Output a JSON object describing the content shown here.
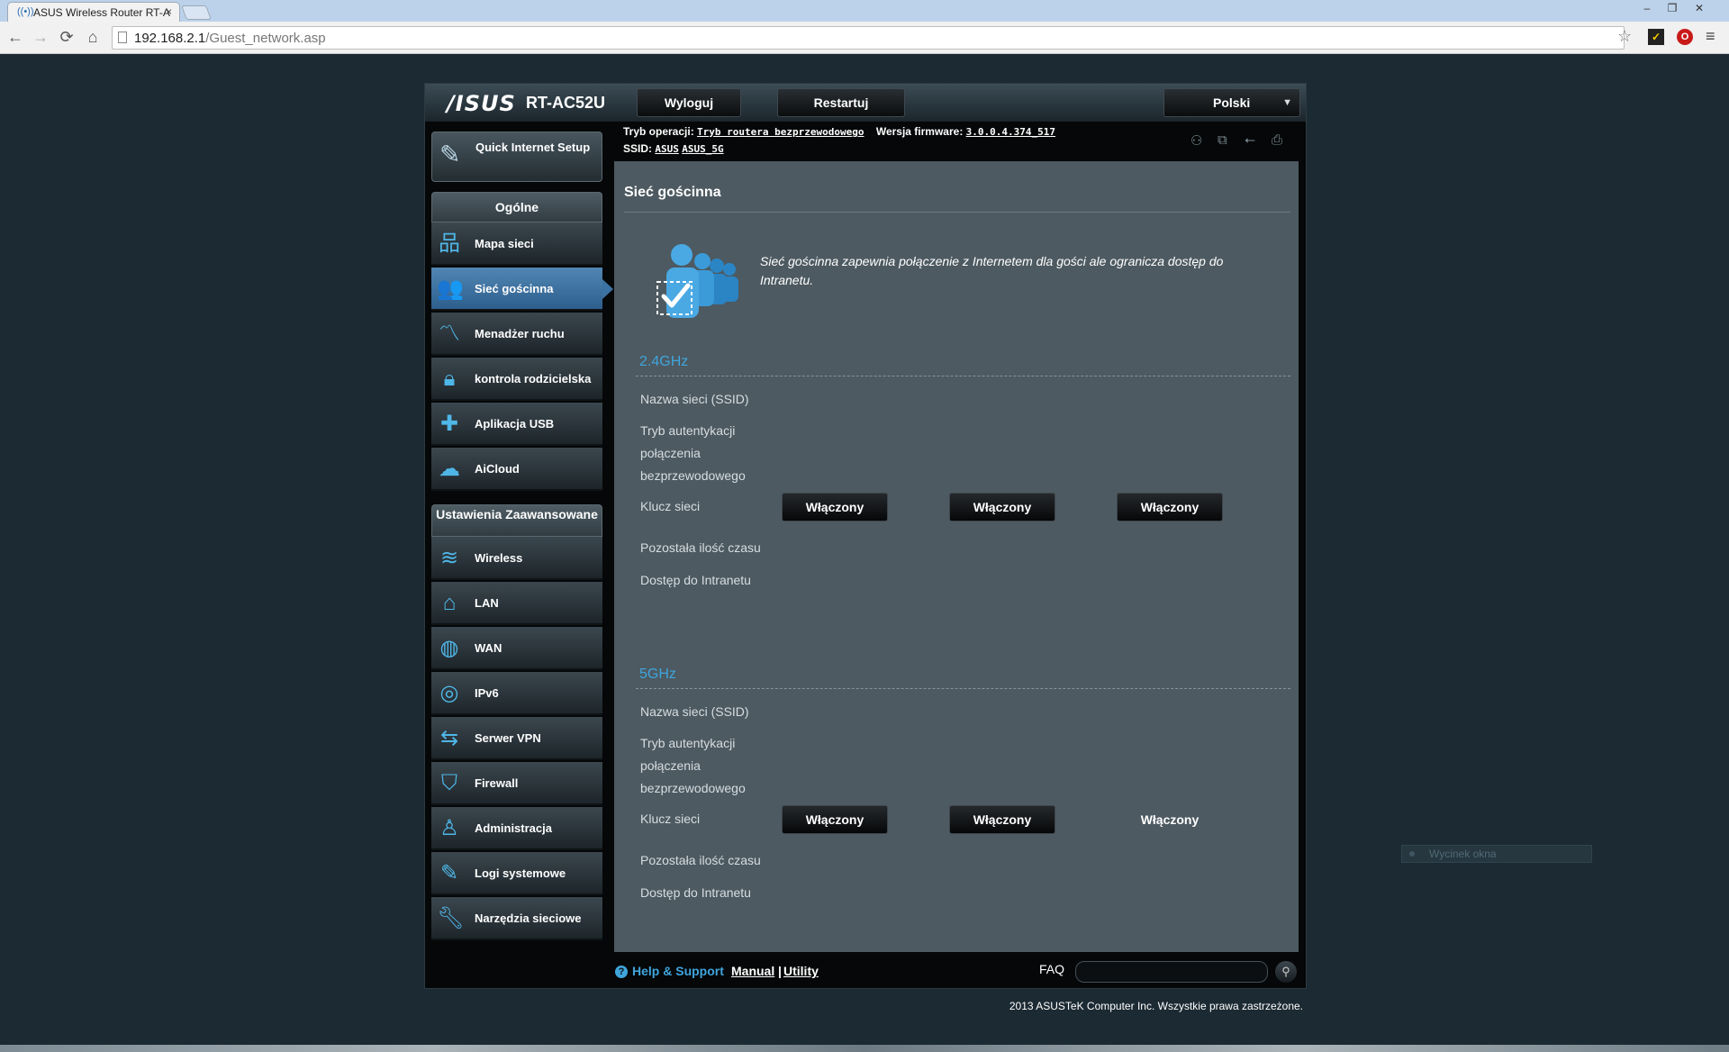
{
  "browser": {
    "tab_title": "ASUS Wireless Router RT-A",
    "tab_close": "×",
    "url_host": "192.168.2.1",
    "url_path": "/Guest_network.asp",
    "nav": {
      "back": "←",
      "forward": "→",
      "reload": "⟳",
      "home": "⌂"
    },
    "window_controls": {
      "minimize": "–",
      "restore": "❐",
      "close": "✕"
    },
    "star": "☆",
    "menu": "≡",
    "ext1": "✓",
    "ext2": "O"
  },
  "router": {
    "logo": "/ISUS",
    "model": "RT-AC52U",
    "logout_label": "Wyloguj",
    "restart_label": "Restartuj",
    "language": "Polski",
    "op_mode_label": "Tryb operacji:",
    "op_mode_value": "Tryb routera bezprzewodowego",
    "firmware_label": "Wersja firmware:",
    "firmware_value": "3.0.0.4.374_517",
    "ssid_label": "SSID:",
    "ssid_values": [
      "ASUS",
      "ASUS_5G"
    ]
  },
  "sidebar": {
    "quick_setup": "Quick Internet Setup",
    "general_header": "Ogólne",
    "general_items": [
      {
        "label": "Mapa sieci",
        "icon": "network-map-icon"
      },
      {
        "label": "Sieć gościnna",
        "icon": "guest-network-icon",
        "active": true
      },
      {
        "label": "Menadżer ruchu",
        "icon": "traffic-manager-icon"
      },
      {
        "label": "kontrola rodzicielska",
        "icon": "lock-icon"
      },
      {
        "label": "Aplikacja USB",
        "icon": "puzzle-icon"
      },
      {
        "label": "AiCloud",
        "icon": "cloud-icon"
      }
    ],
    "advanced_header": "Ustawienia Zaawansowane",
    "advanced_items": [
      {
        "label": "Wireless",
        "icon": "wifi-icon"
      },
      {
        "label": "LAN",
        "icon": "home-icon"
      },
      {
        "label": "WAN",
        "icon": "globe-icon"
      },
      {
        "label": "IPv6",
        "icon": "ipv6-icon"
      },
      {
        "label": "Serwer VPN",
        "icon": "vpn-icon"
      },
      {
        "label": "Firewall",
        "icon": "shield-icon"
      },
      {
        "label": "Administracja",
        "icon": "user-icon"
      },
      {
        "label": "Logi systemowe",
        "icon": "edit-icon"
      },
      {
        "label": "Narzędzia sieciowe",
        "icon": "wrench-icon"
      }
    ]
  },
  "content": {
    "title": "Sieć gościnna",
    "description": "Sieć gościnna zapewnia połączenie z Internetem dla gości ale ogranicza dostęp do Intranetu.",
    "band_24": {
      "title": "2.4GHz",
      "ssid_label": "Nazwa sieci (SSID)",
      "auth_label_lines": [
        "Tryb autentykacji",
        "połączenia",
        "bezprzewodowego"
      ],
      "key_label": "Klucz sieci",
      "time_label": "Pozostała ilość czasu",
      "intranet_label": "Dostęp do Intranetu",
      "buttons": [
        "Włączony",
        "Włączony",
        "Włączony"
      ]
    },
    "band_5": {
      "title": "5GHz",
      "ssid_label": "Nazwa sieci (SSID)",
      "auth_label_lines": [
        "Tryb autentykacji",
        "połączenia",
        "bezprzewodowego"
      ],
      "key_label": "Klucz sieci",
      "time_label": "Pozostała ilość czasu",
      "intranet_label": "Dostęp do Intranetu",
      "buttons": [
        "Włączony",
        "Włączony",
        "Włączony"
      ]
    }
  },
  "footer": {
    "help_support": "Help & Support",
    "help_icon": "?",
    "manual": "Manual",
    "pipe": "|",
    "utility": "Utility",
    "faq": "FAQ",
    "search_icon": "⚲",
    "copyright": "2013 ASUSTeK Computer Inc. Wszystkie prawa zastrzeżone."
  },
  "overlay": {
    "snip_label": "Wycinek okna"
  }
}
